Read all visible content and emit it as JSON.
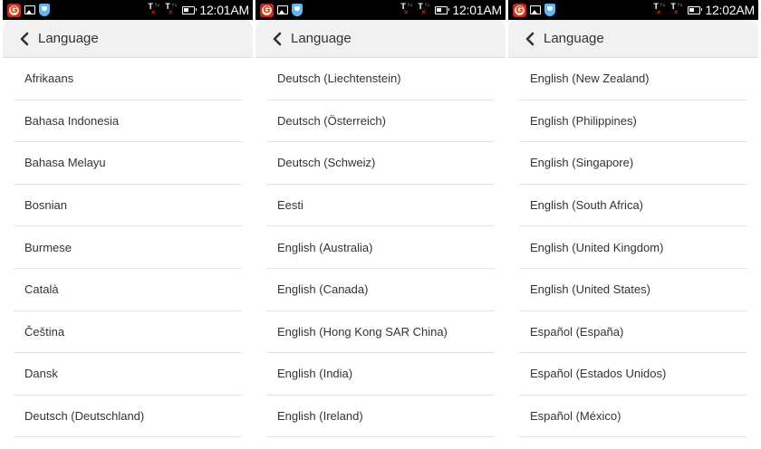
{
  "panels": [
    {
      "time": "12:01AM",
      "title": "Language",
      "items": [
        "Afrikaans",
        "Bahasa Indonesia",
        "Bahasa Melayu",
        "Bosnian",
        "Burmese",
        "Català",
        "Čeština",
        "Dansk",
        "Deutsch (Deutschland)"
      ]
    },
    {
      "time": "12:01AM",
      "title": "Language",
      "items": [
        "Deutsch (Liechtenstein)",
        "Deutsch (Österreich)",
        "Deutsch (Schweiz)",
        "Eesti",
        "English (Australia)",
        "English (Canada)",
        "English (Hong Kong SAR China)",
        "English (India)",
        "English (Ireland)"
      ]
    },
    {
      "time": "12:02AM",
      "title": "Language",
      "items": [
        "English (New Zealand)",
        "English (Philippines)",
        "English (Singapore)",
        "English (South Africa)",
        "English (United Kingdom)",
        "English (United States)",
        "Español (España)",
        "Español (Estados Unidos)",
        "Español (México)"
      ]
    }
  ],
  "status_icons": {
    "left": [
      "g-app-icon",
      "image-icon",
      "shield-icon"
    ],
    "right": [
      "signal-sim1-icon",
      "signal-sim2-icon",
      "battery-icon"
    ],
    "signal_glyph": "T",
    "g_glyph": "G"
  },
  "colors": {
    "status_bar": "#000000",
    "app_bar": "#f1f1f1",
    "text": "#333333",
    "divider": "#e4e4e4",
    "g_app_red": "#c62828",
    "shield_blue": "#64b5f6"
  }
}
